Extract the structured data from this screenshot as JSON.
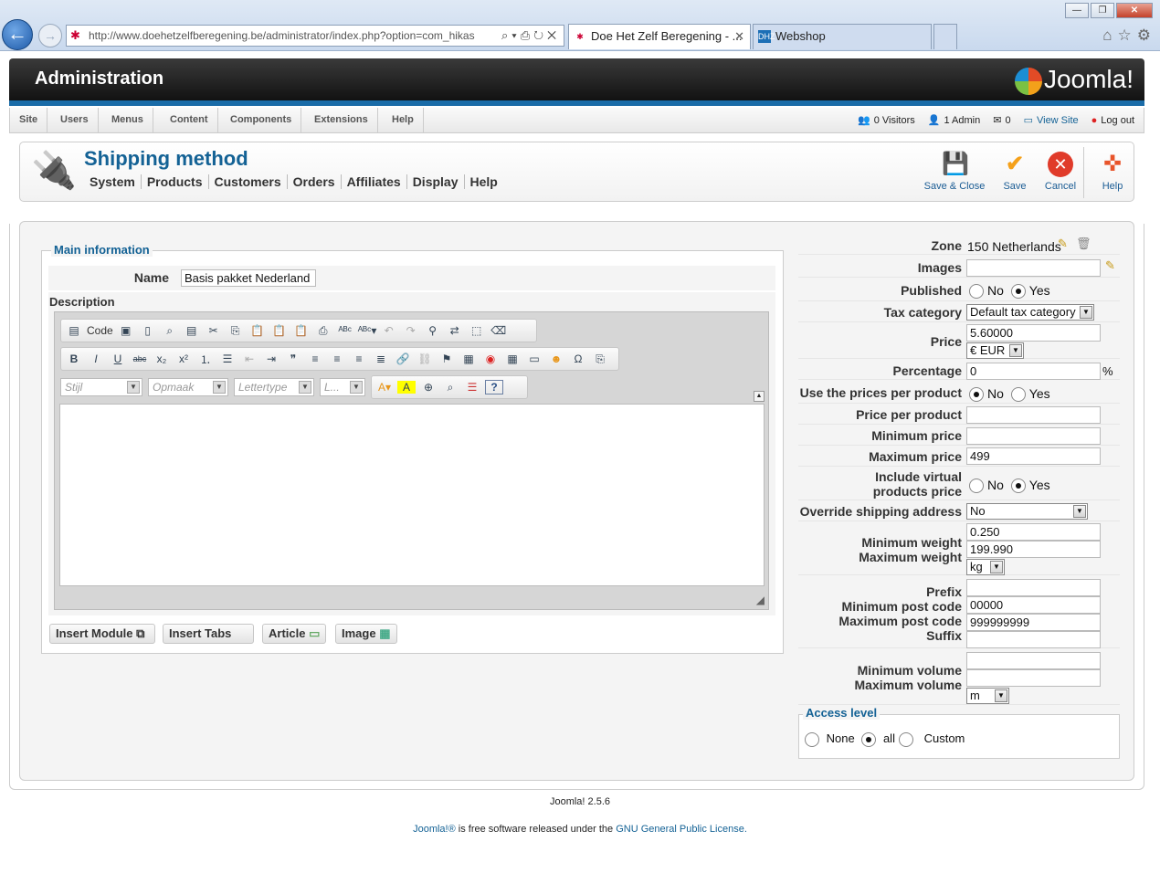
{
  "browser": {
    "address": "http://www.doehetzelfberegening.be/administrator/index.php?option=com_hikas",
    "address_host": "doehetzelfberegening.be",
    "tabs": [
      {
        "label": "Doe Het Zelf Beregening - ..."
      },
      {
        "label": "Webshop"
      }
    ]
  },
  "header": {
    "title": "Administration",
    "logo_text": "Joomla!"
  },
  "menu": [
    "Site",
    "Users",
    "Menus",
    "Content",
    "Components",
    "Extensions",
    "Help"
  ],
  "status": {
    "visitors": "0 Visitors",
    "admins": "1 Admin",
    "messages": "0",
    "view_site": "View Site",
    "logout": "Log out"
  },
  "page": {
    "title": "Shipping method",
    "submenu": [
      "System",
      "Products",
      "Customers",
      "Orders",
      "Affiliates",
      "Display",
      "Help"
    ]
  },
  "toolbar": {
    "save_close": "Save & Close",
    "save": "Save",
    "cancel": "Cancel",
    "help": "Help"
  },
  "main_info": {
    "legend": "Main information",
    "name_label": "Name",
    "name_value": "Basis pakket Nederland",
    "description_label": "Description",
    "editor": {
      "code_label": "Code",
      "style_placeholder": "Stijl",
      "format_placeholder": "Opmaak",
      "font_placeholder": "Lettertype",
      "size_placeholder": "L..."
    },
    "buttons": {
      "insert_module": "Insert Module",
      "insert_tabs": "Insert Tabs",
      "article": "Article",
      "image": "Image"
    }
  },
  "form": {
    "zone_label": "Zone",
    "zone_value": "150 Netherlands",
    "images_label": "Images",
    "published_label": "Published",
    "no": "No",
    "yes": "Yes",
    "tax_label": "Tax category",
    "tax_value": "Default tax category",
    "price_label": "Price",
    "price_value": "5.60000",
    "currency": "€ EUR",
    "percentage_label": "Percentage",
    "percentage_value": "0",
    "percent_sign": "%",
    "use_prices_label": "Use the prices per product",
    "price_per_product_label": "Price per product",
    "min_price_label": "Minimum price",
    "max_price_label": "Maximum price",
    "max_price_value": "499",
    "include_virtual_label_1": "Include virtual",
    "include_virtual_label_2": "products price",
    "override_label": "Override shipping address",
    "override_value": "No",
    "min_weight_label": "Minimum weight",
    "min_weight_value": "0.250",
    "max_weight_label": "Maximum weight",
    "max_weight_value": "199.990",
    "weight_unit": "kg",
    "prefix_label": "Prefix",
    "min_post_label": "Minimum post code",
    "min_post_value": "00000",
    "max_post_label": "Maximum post code",
    "max_post_value": "999999999",
    "suffix_label": "Suffix",
    "min_volume_label": "Minimum volume",
    "max_volume_label": "Maximum volume",
    "volume_unit": "m",
    "access_legend": "Access level",
    "access_none": "None",
    "access_all": "all",
    "access_custom": "Custom"
  },
  "footer": {
    "version": "Joomla! 2.5.6",
    "brand": "Joomla!®",
    "text": " is free software released under the ",
    "license": "GNU General Public License."
  },
  "colors": {
    "accent": "#146295",
    "header_bar": "#1a6ca8"
  }
}
